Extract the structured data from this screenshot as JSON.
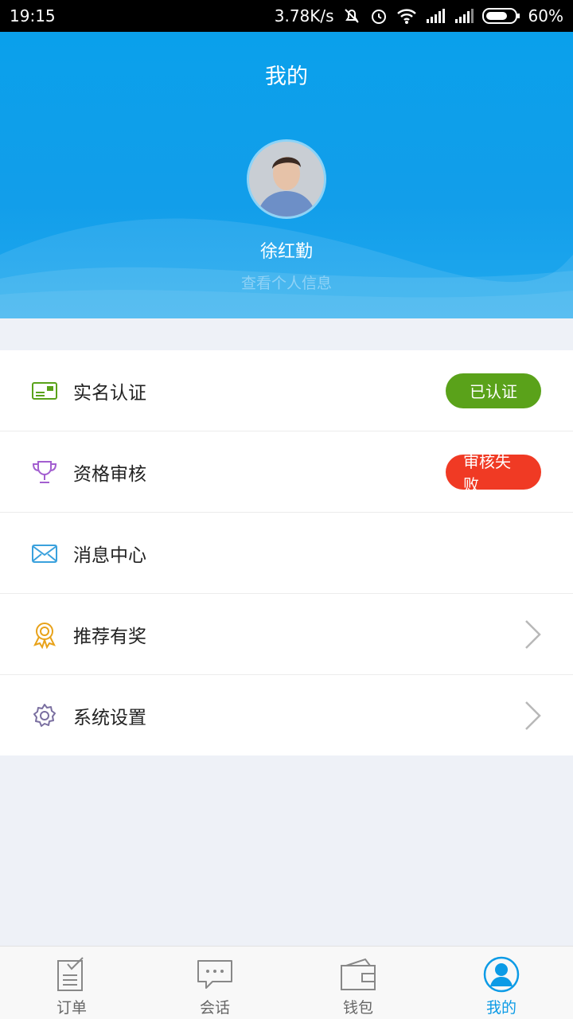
{
  "status_bar": {
    "time": "19:15",
    "net_speed": "3.78K/s",
    "battery": "60%",
    "icons": [
      "mute-icon",
      "alarm-icon",
      "wifi-icon",
      "signal-icon",
      "signal-icon",
      "battery-icon"
    ]
  },
  "header": {
    "title": "我的",
    "user_name": "徐红勤",
    "profile_link": "查看个人信息"
  },
  "menu": {
    "items": [
      {
        "label": "实名认证",
        "icon": "id-card-icon",
        "badge": "已认证",
        "badge_color": "#5aa21a"
      },
      {
        "label": "资格审核",
        "icon": "trophy-icon",
        "badge": "审核失败",
        "badge_color": "#f03a24"
      },
      {
        "label": "消息中心",
        "icon": "envelope-icon"
      },
      {
        "label": "推荐有奖",
        "icon": "award-icon",
        "arrow": "chevron-right-icon"
      },
      {
        "label": "系统设置",
        "icon": "gear-icon",
        "arrow": "chevron-right-icon"
      }
    ]
  },
  "tabbar": {
    "tabs": [
      {
        "label": "订单",
        "icon": "order-list-icon"
      },
      {
        "label": "会话",
        "icon": "chat-bubble-icon"
      },
      {
        "label": "钱包",
        "icon": "wallet-icon"
      },
      {
        "label": "我的",
        "icon": "user-icon",
        "active": true
      }
    ],
    "active_color": "#0c9be6"
  },
  "colors": {
    "header_blue": "#0aa0eb",
    "background": "#eef1f7"
  }
}
